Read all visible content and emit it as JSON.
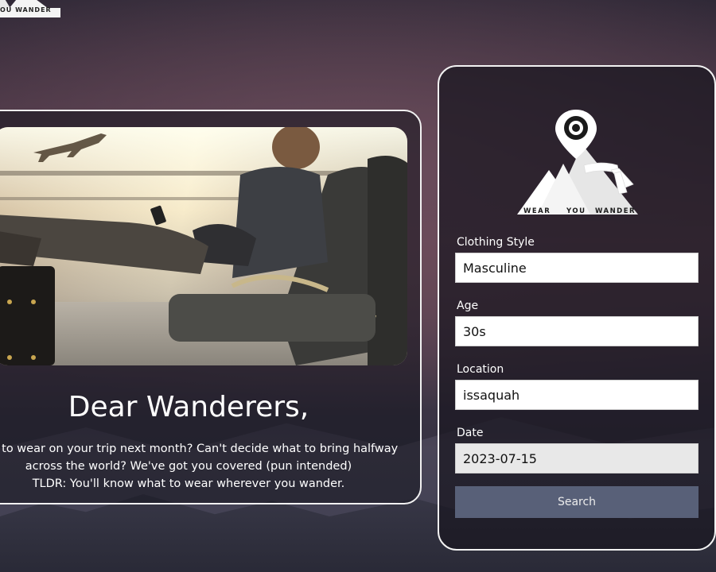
{
  "brand": {
    "name_parts": [
      "WEAR",
      "YOU",
      "WANDER"
    ],
    "top_logo_text": "OU  WANDER"
  },
  "info": {
    "title": "Dear Wanderers,",
    "lines": [
      "hat to wear on your trip next month? Can't decide what to bring halfway",
      "across the world? We've got you covered (pun intended)",
      "TLDR: You'll know what to wear wherever you wander."
    ]
  },
  "form": {
    "clothing_style": {
      "label": "Clothing Style",
      "value": "Masculine"
    },
    "age": {
      "label": "Age",
      "value": "30s"
    },
    "location": {
      "label": "Location",
      "value": "issaquah"
    },
    "date": {
      "label": "Date",
      "value": "2023-07-15"
    },
    "submit_label": "Search"
  },
  "colors": {
    "card_border": "#f2f2f2",
    "button_bg": "#586078",
    "button_text": "#ececec",
    "input_bg": "#ffffff",
    "date_input_bg": "#e8e8e8"
  }
}
